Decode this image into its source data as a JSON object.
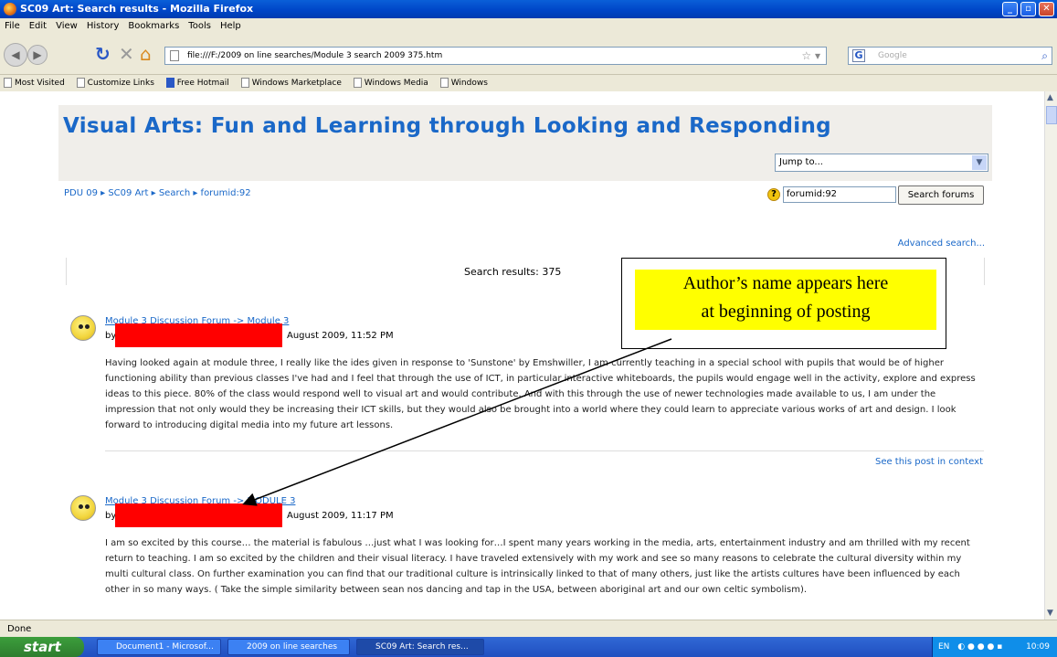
{
  "window": {
    "title": "SC09 Art: Search results - Mozilla Firefox"
  },
  "menu": [
    "File",
    "Edit",
    "View",
    "History",
    "Bookmarks",
    "Tools",
    "Help"
  ],
  "address": {
    "url": "file:///F:/2009 on line searches/Module 3 search 2009 375.htm"
  },
  "search_engine": {
    "label": "G",
    "placeholder": "Google"
  },
  "bookmarks": [
    "Most Visited",
    "Customize Links",
    "Free Hotmail",
    "Windows Marketplace",
    "Windows Media",
    "Windows"
  ],
  "page": {
    "title": "Visual Arts: Fun and Learning through Looking and Responding",
    "jump_to": "Jump to...",
    "breadcrumb": "PDU 09 ▸ SC09 Art ▸ Search ▸ forumid:92",
    "search_value": "forumid:92",
    "search_button": "Search forums",
    "advanced_search": "Advanced search...",
    "results_label": "Search results: 375"
  },
  "posts": [
    {
      "subject": "Module 3 Discussion Forum -> Module 3",
      "by": "by",
      "date": "August 2009, 11:52 PM",
      "body": "Having looked again at module three, I really like the ides given in response to 'Sunstone' by Emshwiller,  I am currently teaching in a special school with pupils that would be of higher functioning ability than previous classes I've had and I feel that through the use of ICT, in particular interactive whiteboards, the pupils would engage well in the activity, explore and express ideas to this piece.  80% of the class would respond well to visual art and would contribute.  And with this through the use of newer technologies made available to us, I am under the impression that not only would they be increasing their ICT skills, but they would also be brought into a world where they could learn to appreciate various works of art and design.  I look forward to introducing digital media into my future art lessons.",
      "context_link": "See this post in context"
    },
    {
      "subject": "Module 3 Discussion Forum -> MODULE 3",
      "by": "by",
      "date": "August 2009, 11:17 PM",
      "body": "I am so excited by this course… the material is fabulous …just what I was looking for…I spent many years working in the media, arts, entertainment industry and am thrilled with my recent return to teaching. I am so excited by the children and their visual literacy. I have traveled extensively with my work and see so many reasons to celebrate the cultural diversity within my multi cultural class. On further examination you can find that our traditional culture is intrinsically linked to that of many others, just like the artists cultures have been influenced by each other in so many ways. ( Take the simple similarity between sean nos dancing and tap in the USA, between aboriginal art and our own celtic symbolism)."
    }
  ],
  "callout": {
    "line1": "Author’s name appears here",
    "line2": "at beginning of posting",
    "color": "#ffff00"
  },
  "status": "Done",
  "taskbar": {
    "start": "start",
    "tasks": [
      "Document1 - Microsof...",
      "2009 on line searches",
      "SC09 Art: Search res..."
    ],
    "lang": "EN",
    "clock": "10:09"
  },
  "colors": {
    "link": "#1a68c8",
    "redaction": "#ff0000",
    "titlebar": "#0046c8"
  }
}
